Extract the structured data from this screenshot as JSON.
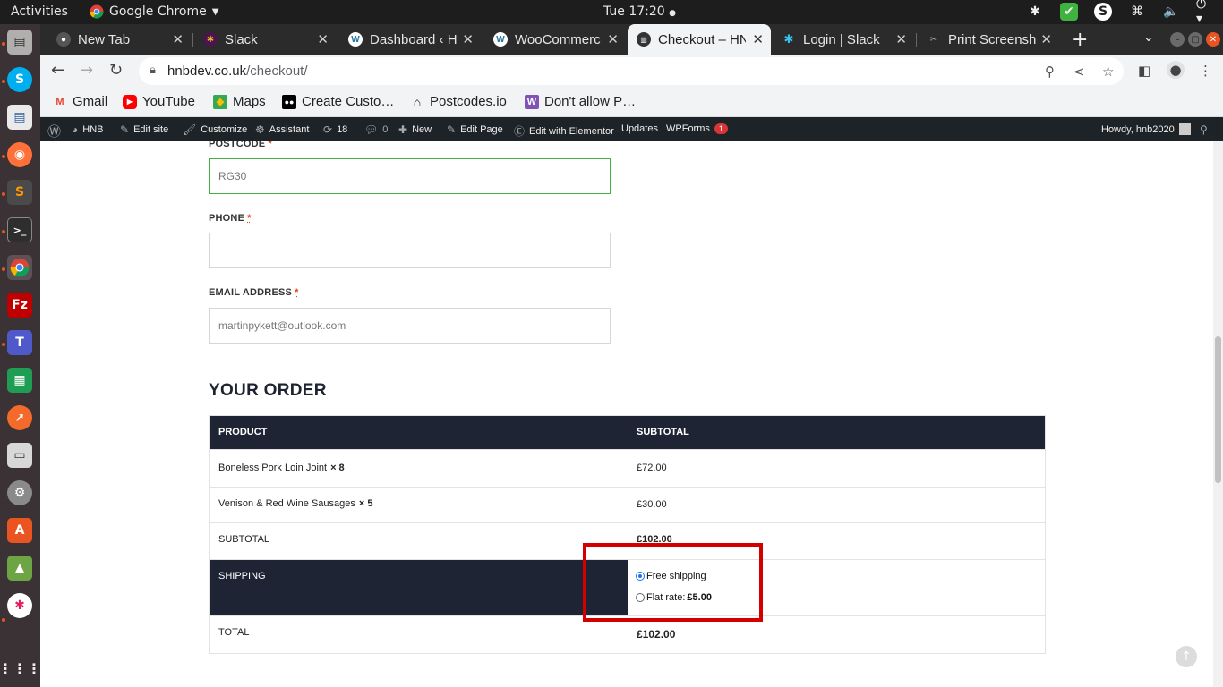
{
  "topbar": {
    "activities": "Activities",
    "app_name": "Google Chrome",
    "clock": "Tue 17:20"
  },
  "dock": {
    "items": [
      "files-icon",
      "skype-icon",
      "document-viewer-icon",
      "firefox-icon",
      "sublime-text-icon",
      "terminal-icon",
      "chrome-icon",
      "filezilla-icon",
      "teams-icon",
      "spreadsheet-icon",
      "compass-icon",
      "printer-icon",
      "settings-icon",
      "software-center-icon",
      "image-viewer-icon",
      "slack-icon",
      "show-apps-icon"
    ]
  },
  "tabs": [
    {
      "title": "New Tab",
      "icon": "github-icon",
      "active": false
    },
    {
      "title": "Slack",
      "icon": "slack-icon",
      "active": false
    },
    {
      "title": "Dashboard ‹ H",
      "icon": "wordpress-icon",
      "active": false
    },
    {
      "title": "WooCommerc",
      "icon": "wordpress-icon",
      "active": false
    },
    {
      "title": "Checkout – HN",
      "icon": "hnb-icon",
      "active": true
    },
    {
      "title": "Login | Slack",
      "icon": "slack-icon",
      "active": false
    },
    {
      "title": "Print Screensh",
      "icon": "print-screen-icon",
      "active": false
    }
  ],
  "omnibox": {
    "domain": "hnbdev.co.uk",
    "path": "/checkout/"
  },
  "bookmarks": [
    {
      "label": "Gmail",
      "icon": "gmail-icon"
    },
    {
      "label": "YouTube",
      "icon": "youtube-icon"
    },
    {
      "label": "Maps",
      "icon": "maps-icon"
    },
    {
      "label": "Create Custo…",
      "icon": "medium-icon"
    },
    {
      "label": "Postcodes.io",
      "icon": "home-icon"
    },
    {
      "label": "Don't allow P…",
      "icon": "woo-icon"
    }
  ],
  "wpbar": {
    "site": "HNB",
    "edit_site": "Edit site",
    "customize": "Customize",
    "assistant": "Assistant",
    "updates_count": "18",
    "comments_count": "0",
    "new": "New",
    "edit_page": "Edit Page",
    "elementor": "Edit with Elementor",
    "updates": "Updates",
    "wpforms": "WPForms",
    "wpforms_badge": "1",
    "howdy": "Howdy, hnb2020"
  },
  "form": {
    "postcode_label": "POSTCODE",
    "postcode_value": "RG30",
    "phone_label": "PHONE",
    "phone_value": "",
    "email_label": "EMAIL ADDRESS",
    "email_value": "martinpykett@outlook.com",
    "required_mark": "*"
  },
  "order": {
    "heading": "YOUR ORDER",
    "col_product": "PRODUCT",
    "col_subtotal": "SUBTOTAL",
    "items": [
      {
        "name": "Boneless Pork Loin Joint",
        "qty": "× 8",
        "price": "£72.00"
      },
      {
        "name": "Venison & Red Wine Sausages",
        "qty": "× 5",
        "price": "£30.00"
      }
    ],
    "subtotal_label": "SUBTOTAL",
    "subtotal_value": "£102.00",
    "shipping_label": "SHIPPING",
    "shipping_options": [
      {
        "label": "Free shipping",
        "price": "",
        "checked": true
      },
      {
        "label": "Flat rate: ",
        "price": "£5.00",
        "checked": false
      }
    ],
    "total_label": "TOTAL",
    "total_value": "£102.00"
  },
  "colors": {
    "table_header_bg": "#1e2434",
    "highlight_border": "#d40000",
    "valid_field_border": "#3fb23f"
  }
}
